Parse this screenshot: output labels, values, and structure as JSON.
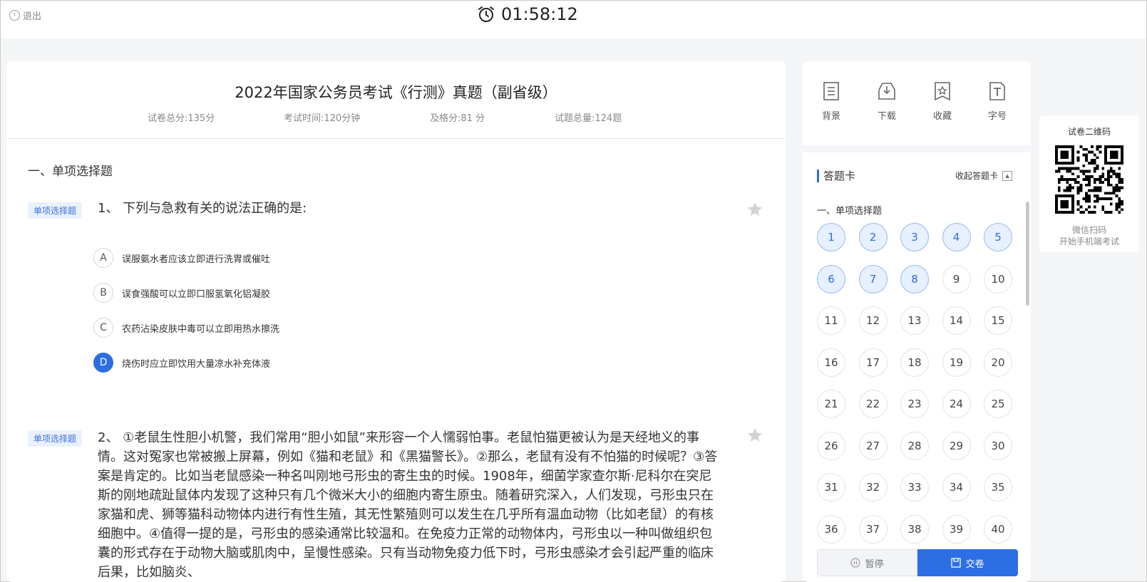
{
  "topbar": {
    "exit_label": "退出",
    "timer": "01:58:12"
  },
  "paper": {
    "title": "2022年国家公务员考试《行测》真题（副省级）",
    "total_score": "试卷总分:135分",
    "exam_time": "考试时间:120分钟",
    "pass_score": "及格分:81 分",
    "question_total": "试题总量:124题"
  },
  "section_title": "一、单项选择题",
  "questions": [
    {
      "tag": "单项选择题",
      "stem": "1、  下列与急救有关的说法正确的是:",
      "options": [
        {
          "key": "A",
          "text": "误服氨水者应该立即进行洗胃或催吐",
          "selected": false
        },
        {
          "key": "B",
          "text": "误食强酸可以立即口服氢氧化铝凝胶",
          "selected": false
        },
        {
          "key": "C",
          "text": "农药沾染皮肤中毒可以立即用热水擦洗",
          "selected": false
        },
        {
          "key": "D",
          "text": "烧伤时应立即饮用大量凉水补充体液",
          "selected": true
        }
      ]
    },
    {
      "tag": "单项选择题",
      "stem": "2、  ①老鼠生性胆小机警，我们常用“胆小如鼠”来形容一个人懦弱怕事。老鼠怕猫更被认为是天经地义的事情。这对冤家也常被搬上屏幕，例如《猫和老鼠》和《黑猫警长》。②那么，老鼠有没有不怕猫的时候呢？③答案是肯定的。比如当老鼠感染一种名叫刚地弓形虫的寄生虫的时候。1908年，细菌学家查尔斯·尼科尔在突尼斯的刚地疏趾鼠体内发现了这种只有几个微米大小的细胞内寄生原虫。随着研究深入，人们发现，弓形虫只在家猫和虎、狮等猫科动物体内进行有性生殖，其无性繁殖则可以发生在几乎所有温血动物（比如老鼠）的有核细胞中。④值得一提的是，弓形虫的感染通常比较温和。在免疫力正常的动物体内，弓形虫以一种叫做组织包囊的形式存在于动物大脑或肌肉中，呈慢性感染。只有当动物免疫力低下时，弓形虫感染才会引起严重的临床后果，比如脑炎、"
    }
  ],
  "tools": [
    {
      "label": "背景",
      "icon": "background-icon"
    },
    {
      "label": "下载",
      "icon": "download-icon"
    },
    {
      "label": "收藏",
      "icon": "favorite-icon"
    },
    {
      "label": "字号",
      "icon": "font-size-icon"
    }
  ],
  "answer_card": {
    "title": "答题卡",
    "collapse_label": "收起答题卡",
    "section": "一、单项选择题",
    "numbers": [
      "1",
      "2",
      "3",
      "4",
      "5",
      "6",
      "7",
      "8",
      "9",
      "10",
      "11",
      "12",
      "13",
      "14",
      "15",
      "16",
      "17",
      "18",
      "19",
      "20",
      "21",
      "22",
      "23",
      "24",
      "25",
      "26",
      "27",
      "28",
      "29",
      "30",
      "31",
      "32",
      "33",
      "34",
      "35",
      "36",
      "37",
      "38",
      "39",
      "40"
    ],
    "answered": [
      "1",
      "2",
      "3",
      "4",
      "5",
      "6",
      "7",
      "8"
    ]
  },
  "actions": {
    "pause_label": "暂停",
    "submit_label": "交卷"
  },
  "qr": {
    "title": "试卷二维码",
    "caption1": "微信扫码",
    "caption2": "开始手机端考试"
  },
  "colors": {
    "accent": "#2c6ee4",
    "answered_bg": "#e7f0ff",
    "page_bg": "#f4f5f7"
  }
}
